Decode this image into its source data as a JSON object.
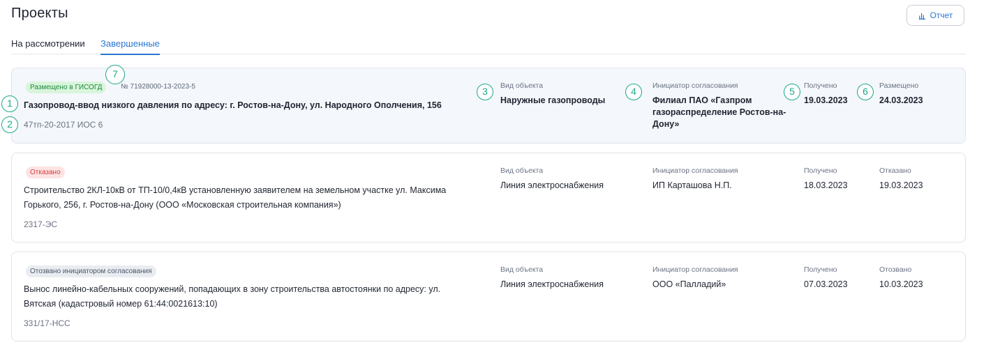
{
  "header": {
    "title": "Проекты",
    "report_label": "Отчет",
    "report_icon": "bar-chart-icon"
  },
  "tabs": [
    {
      "label": "На рассмотрении",
      "active": false
    },
    {
      "label": "Завершенные",
      "active": true
    }
  ],
  "cards": [
    {
      "status": "Размещено в ГИСОГД",
      "status_color": "#1f8a3a",
      "number": "№ 71928000-13-2023-5",
      "title": "Газопровод-ввод низкого давления по адресу: г. Ростов-на-Дону, ул. Народного Ополчения, 156",
      "code": "47тп-20-2017 ИОС 6",
      "object_type_label": "Вид объекта",
      "object_type": "Наружные газопроводы",
      "initiator_label": "Инициатор согласования",
      "initiator": "Филиал ПАО «Газпром газораспределение Ростов-на-Дону»",
      "received_label": "Получено",
      "received": "19.03.2023",
      "final_label": "Размещено",
      "final": "24.03.2023"
    },
    {
      "status": "Отказано",
      "status_color": "#d93b3b",
      "title": "Строительство 2КЛ-10кВ от ТП-10/0,4кВ установленную заявителем на земельном участке ул. Максима Горького, 256, г. Ростов-на-Дону (ООО «Московская строительная компания»)",
      "code": "2317-ЭС",
      "object_type_label": "Вид объекта",
      "object_type": "Линия электроснабжения",
      "initiator_label": "Инициатор согласования",
      "initiator": "ИП Карташова Н.П.",
      "received_label": "Получено",
      "received": "18.03.2023",
      "final_label": "Отказано",
      "final": "19.03.2023"
    },
    {
      "status": "Отозвано инициатором согласования",
      "status_color": "#4c5566",
      "title": "Вынос линейно-кабельных сооружений, попадающих в зону строительства автостоянки по адресу: ул. Вятская (кадастровый номер 61:44:0021613:10)",
      "code": "331/17-НСС",
      "object_type_label": "Вид объекта",
      "object_type": "Линия электроснабжения",
      "initiator_label": "Инициатор согласования",
      "initiator": "ООО «Палладий»",
      "received_label": "Получено",
      "received": "07.03.2023",
      "final_label": "Отозвано",
      "final": "10.03.2023"
    }
  ],
  "markers": [
    "1",
    "2",
    "3",
    "4",
    "5",
    "6",
    "7"
  ],
  "colors": {
    "accent": "#2a76d2",
    "marker": "#1ba88a"
  }
}
